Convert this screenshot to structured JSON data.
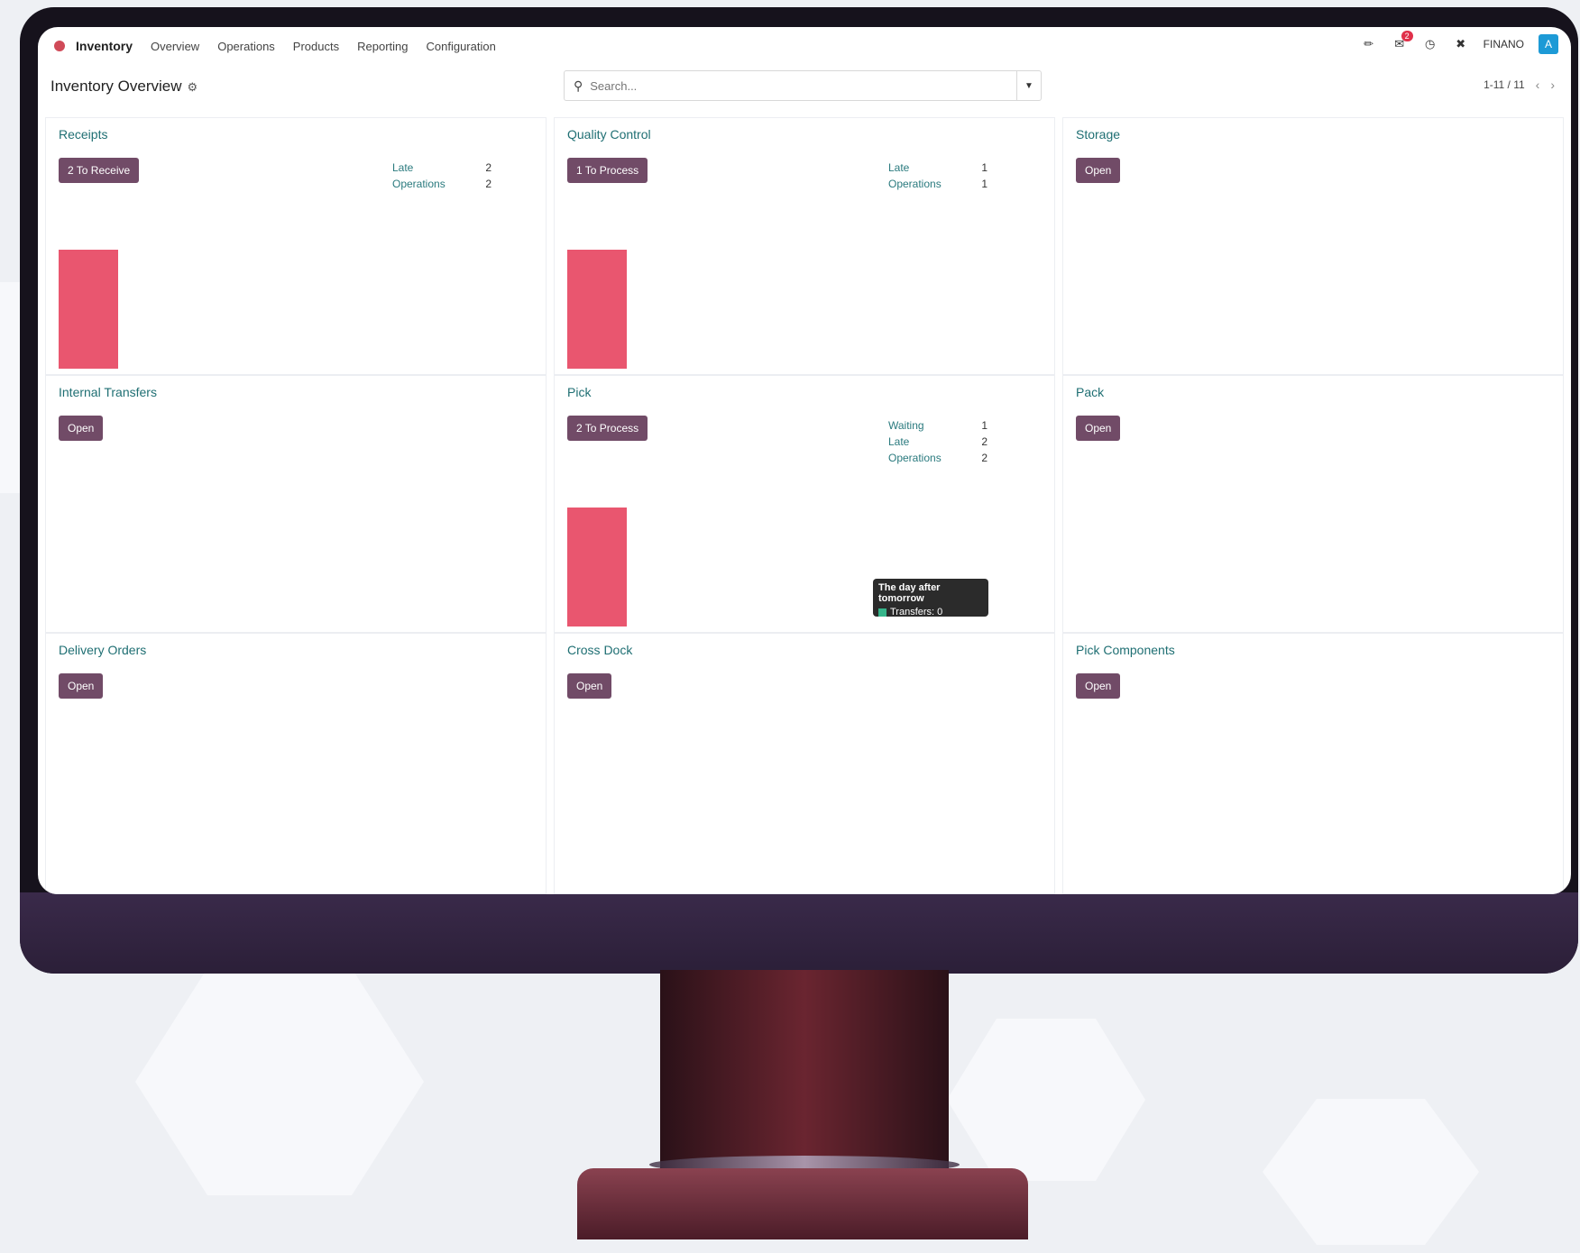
{
  "navbar": {
    "app_name": "Inventory",
    "menu": [
      "Overview",
      "Operations",
      "Products",
      "Reporting",
      "Configuration"
    ],
    "messages_count": "2",
    "company": "FINANO",
    "avatar_initial": "A"
  },
  "control_panel": {
    "title": "Inventory Overview",
    "search_placeholder": "Search...",
    "pager": "1-11 / 11"
  },
  "cards": [
    {
      "title": "Receipts",
      "button": "2 To Receive",
      "stats": [
        {
          "label": "Late",
          "value": "2"
        },
        {
          "label": "Operations",
          "value": "2"
        }
      ],
      "bar": 1
    },
    {
      "title": "Quality Control",
      "button": "1 To Process",
      "stats": [
        {
          "label": "Late",
          "value": "1"
        },
        {
          "label": "Operations",
          "value": "1"
        }
      ],
      "bar": 1
    },
    {
      "title": "Storage",
      "button": "Open"
    },
    {
      "title": "Internal Transfers",
      "button": "Open"
    },
    {
      "title": "Pick",
      "button": "2 To Process",
      "stats": [
        {
          "label": "Waiting",
          "value": "1"
        },
        {
          "label": "Late",
          "value": "2"
        },
        {
          "label": "Operations",
          "value": "2"
        }
      ],
      "bar": 1
    },
    {
      "title": "Pack",
      "button": "Open"
    },
    {
      "title": "Delivery Orders",
      "button": "Open"
    },
    {
      "title": "Cross Dock",
      "button": "Open"
    },
    {
      "title": "Pick Components",
      "button": "Open"
    }
  ],
  "tooltip": {
    "title": "The day after tomorrow",
    "series": "Transfers: 0"
  },
  "colors": {
    "accent": "#714b67",
    "bar": "#e9566f",
    "title_teal": "#1f6f73"
  }
}
